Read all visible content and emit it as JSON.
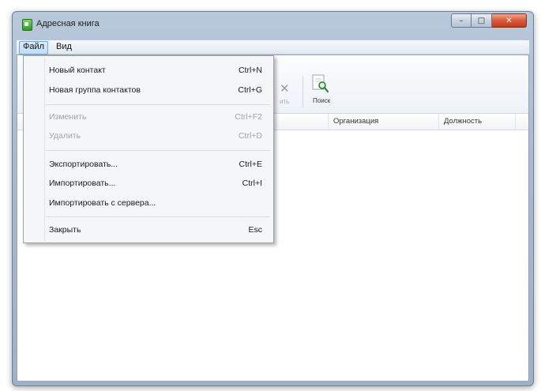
{
  "window": {
    "title": "Адресная книга"
  },
  "menubar": {
    "file": "Файл",
    "view": "Вид"
  },
  "file_menu": {
    "items": [
      {
        "label": "Новый контакт",
        "shortcut": "Ctrl+N",
        "enabled": true
      },
      {
        "label": "Новая группа контактов",
        "shortcut": "Ctrl+G",
        "enabled": true
      },
      {
        "label": "Изменить",
        "shortcut": "Ctrl+F2",
        "enabled": false
      },
      {
        "label": "Удалить",
        "shortcut": "Ctrl+D",
        "enabled": false
      },
      {
        "label": "Экспортировать...",
        "shortcut": "Ctrl+E",
        "enabled": true
      },
      {
        "label": "Импортировать...",
        "shortcut": "Ctrl+I",
        "enabled": true
      },
      {
        "label": "Импортировать с сервера...",
        "shortcut": "",
        "enabled": true
      },
      {
        "label": "Закрыть",
        "shortcut": "Esc",
        "enabled": true
      }
    ]
  },
  "toolbar": {
    "delete_label": "ить",
    "search_label": "Поиск"
  },
  "table": {
    "columns": [
      "Организация",
      "Должность"
    ]
  },
  "colors": {
    "accent": "#c1dcf7",
    "close_button": "#d85a3d",
    "disabled_text": "#a3a3a3"
  },
  "icons": {
    "app": "address-book-icon",
    "delete": "close-x-icon",
    "search": "search-icon"
  }
}
